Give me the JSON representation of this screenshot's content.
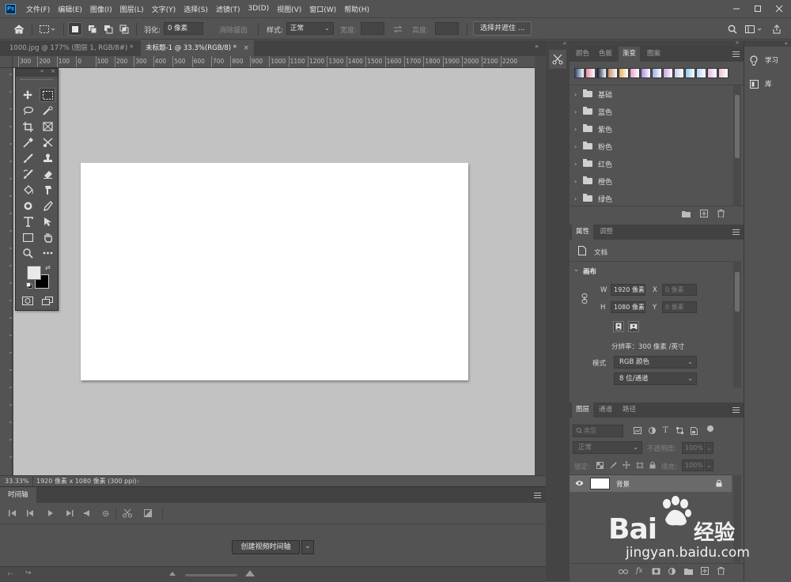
{
  "menubar": {
    "logo": "Ps",
    "items": [
      "文件(F)",
      "编辑(E)",
      "图像(I)",
      "图层(L)",
      "文字(Y)",
      "选择(S)",
      "滤镜(T)",
      "3D(D)",
      "视图(V)",
      "窗口(W)",
      "帮助(H)"
    ]
  },
  "options": {
    "feather_label": "羽化:",
    "feather_value": "0 像素",
    "antialias_label": "消除锯齿",
    "style_label": "样式:",
    "style_value": "正常",
    "width_label": "宽度:",
    "height_label": "高度:",
    "select_mask_button": "选择并遮住 ..."
  },
  "tabs": [
    {
      "label": "1000.jpg @ 177% (图层 1, RGB/8#) *",
      "active": false
    },
    {
      "label": "未标题-1 @ 33.3%(RGB/8) *",
      "active": true
    }
  ],
  "ruler": {
    "h_ticks": [
      "300",
      "200",
      "100",
      "0",
      "100",
      "200",
      "300",
      "400",
      "500",
      "600",
      "700",
      "800",
      "900",
      "1000",
      "1100",
      "1200",
      "1300",
      "1400",
      "1500",
      "1600",
      "1700",
      "1800",
      "1900",
      "2000",
      "2100",
      "2200"
    ]
  },
  "status": {
    "zoom": "33.33%",
    "info": "1920 像素 x 1080 像素 (300 ppi)"
  },
  "timeline": {
    "title": "时间轴",
    "create_button": "创建视频时间轴"
  },
  "gradient_panel": {
    "tabs": [
      "颜色",
      "色板",
      "渐变",
      "图案"
    ],
    "active_tab": "渐变",
    "swatches": [
      "#2e4a7a",
      "#e88aa8",
      "#0e1e3a",
      "#c09070",
      "#e6b060",
      "#e8a0c8",
      "#a890e8",
      "#9ab0e8",
      "#d0a0e0",
      "#c8c8f0",
      "#8ac8f0",
      "#b8d0f0",
      "#e0b8e8",
      "#f0c0d8"
    ],
    "folders": [
      "基础",
      "蓝色",
      "紫色",
      "粉色",
      "红色",
      "橙色",
      "绿色"
    ]
  },
  "properties_panel": {
    "tabs": [
      "属性",
      "调整"
    ],
    "active_tab": "属性",
    "doc_label": "文档",
    "section_title": "画布",
    "w_label": "W",
    "w_value": "1920 像素",
    "h_label": "H",
    "h_value": "1080 像素",
    "x_label": "X",
    "x_value": "0 像素",
    "y_label": "Y",
    "y_value": "0 像素",
    "resolution": "分辨率：300 像素 /英寸",
    "mode_label": "模式",
    "mode_value": "RGB 颜色",
    "depth_value": "8 位/通道"
  },
  "layers_panel": {
    "tabs": [
      "图层",
      "通道",
      "路径"
    ],
    "active_tab": "图层",
    "search_placeholder": "类型",
    "blend_mode": "正常",
    "opacity_label": "不透明度:",
    "opacity_value": "100%",
    "lock_label": "锁定:",
    "fill_label": "填充:",
    "fill_value": "100%",
    "layer_name": "背景"
  },
  "right_bar": {
    "learn": "学习",
    "library": "库"
  },
  "watermark": {
    "brand": "Bai",
    "brand2": "经验",
    "url": "jingyan.baidu.com"
  }
}
